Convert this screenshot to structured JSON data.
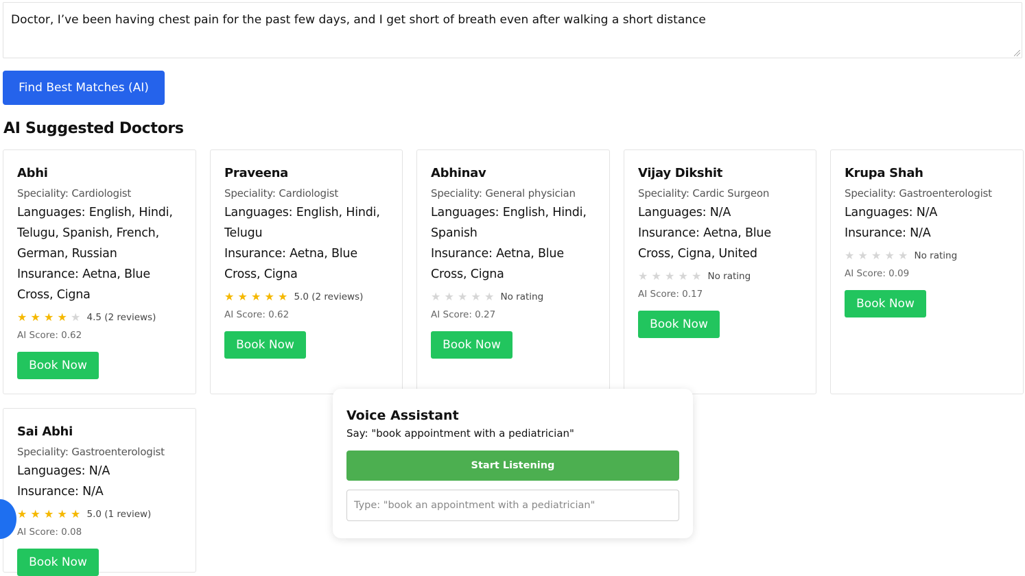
{
  "symptoms": {
    "value": "Doctor, I’ve been having chest pain for the past few days, and I get short of breath even after walking a short distance"
  },
  "find_button": {
    "label": "Find Best Matches (AI)"
  },
  "section_title": "AI Suggested Doctors",
  "labels": {
    "speciality": "Speciality: ",
    "languages": "Languages: ",
    "insurance": "Insurance: ",
    "ai_score": "AI Score: ",
    "book": "Book Now"
  },
  "doctors": [
    {
      "name": "Abhi",
      "speciality": "Cardiologist",
      "languages": "English, Hindi, Telugu, Spanish, French, German, Russian",
      "insurance": "Aetna, Blue Cross, Cigna",
      "rating": 4,
      "rating_text": "4.5 (2 reviews)",
      "ai_score": "0.62"
    },
    {
      "name": "Praveena",
      "speciality": "Cardiologist",
      "languages": "English, Hindi, Telugu",
      "insurance": "Aetna, Blue Cross, Cigna",
      "rating": 5,
      "rating_text": "5.0 (2 reviews)",
      "ai_score": "0.62"
    },
    {
      "name": "Abhinav",
      "speciality": "General physician",
      "languages": "English, Hindi, Spanish",
      "insurance": "Aetna, Blue Cross, Cigna",
      "rating": 0,
      "rating_text": "No rating",
      "ai_score": "0.27"
    },
    {
      "name": "Vijay Dikshit",
      "speciality": "Cardic Surgeon",
      "languages": "N/A",
      "insurance": "Aetna, Blue Cross, Cigna, United",
      "rating": 0,
      "rating_text": "No rating",
      "ai_score": "0.17"
    },
    {
      "name": "Krupa Shah",
      "speciality": "Gastroenterologist",
      "languages": "N/A",
      "insurance": "N/A",
      "rating": 0,
      "rating_text": "No rating",
      "ai_score": "0.09"
    },
    {
      "name": "Sai Abhi",
      "speciality": "Gastroenterologist",
      "languages": "N/A",
      "insurance": "N/A",
      "rating": 5,
      "rating_text": "5.0 (1 review)",
      "ai_score": "0.08"
    }
  ],
  "voice": {
    "title": "Voice Assistant",
    "hint": "Say: \"book appointment with a pediatrician\"",
    "listen_label": "Start Listening",
    "placeholder": "Type: \"book an appointment with a pediatrician\""
  },
  "colors": {
    "primary": "#2563eb",
    "book": "#22c55e",
    "listen": "#4caf50",
    "star": "#f5b800"
  }
}
